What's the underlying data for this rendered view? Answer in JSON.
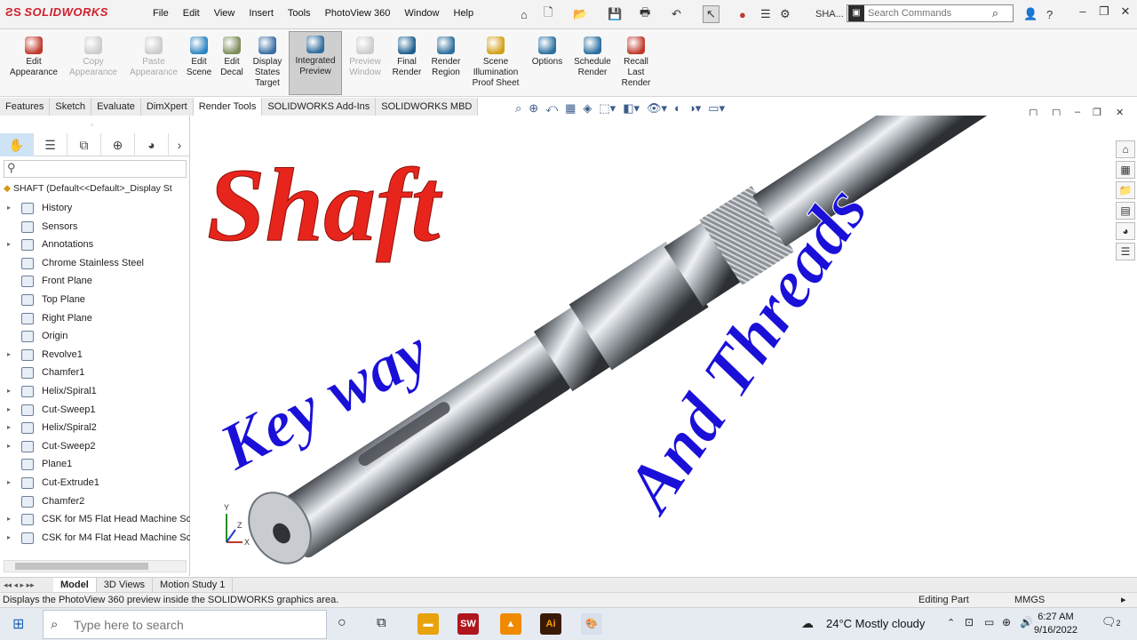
{
  "app": {
    "logo_text": "SOLIDWORKS",
    "menu": [
      "File",
      "Edit",
      "View",
      "Insert",
      "Tools",
      "PhotoView 360",
      "Window",
      "Help"
    ],
    "doc_title": "SHA...",
    "search_placeholder": "Search Commands"
  },
  "ribbon": [
    {
      "label": "Edit Appearance",
      "icon": "appearance-icon",
      "color": "#c0392b",
      "state": "normal"
    },
    {
      "label": "Copy Appearance",
      "icon": "copy-appearance-icon",
      "color": "#cccccc",
      "state": "disabled"
    },
    {
      "label": "Paste Appearance",
      "icon": "paste-appearance-icon",
      "color": "#cccccc",
      "state": "disabled"
    },
    {
      "label": "Edit Scene",
      "icon": "scene-icon",
      "color": "#2e86c1",
      "state": "normal"
    },
    {
      "label": "Edit Decal",
      "icon": "decal-icon",
      "color": "#7d8c5a",
      "state": "normal"
    },
    {
      "label": "Display States Target",
      "icon": "display-states-icon",
      "color": "#3a6ea5",
      "state": "normal"
    },
    {
      "label": "Integrated Preview",
      "icon": "integrated-preview-icon",
      "color": "#2f6d9e",
      "state": "active"
    },
    {
      "label": "Preview Window",
      "icon": "preview-window-icon",
      "color": "#cccccc",
      "state": "disabled"
    },
    {
      "label": "Final Render",
      "icon": "final-render-icon",
      "color": "#1f5f8f",
      "state": "normal"
    },
    {
      "label": "Render Region",
      "icon": "render-region-icon",
      "color": "#2d6f9a",
      "state": "normal"
    },
    {
      "label": "Scene Illumination Proof Sheet",
      "icon": "proof-sheet-icon",
      "color": "#d4a017",
      "state": "normal"
    },
    {
      "label": "Options",
      "icon": "options-icon",
      "color": "#2b6fa0",
      "state": "normal"
    },
    {
      "label": "Schedule Render",
      "icon": "schedule-render-icon",
      "color": "#2b6fa0",
      "state": "normal"
    },
    {
      "label": "Recall Last Render",
      "icon": "recall-render-icon",
      "color": "#c0392b",
      "state": "normal"
    }
  ],
  "tabs": [
    {
      "label": "Features",
      "active": false
    },
    {
      "label": "Sketch",
      "active": false
    },
    {
      "label": "Evaluate",
      "active": false
    },
    {
      "label": "DimXpert",
      "active": false
    },
    {
      "label": "Render Tools",
      "active": true
    },
    {
      "label": "SOLIDWORKS Add-Ins",
      "active": false
    },
    {
      "label": "SOLIDWORKS MBD",
      "active": false
    }
  ],
  "tree": {
    "root": "SHAFT  (Default<<Default>_Display St",
    "items": [
      {
        "label": "History",
        "expand": true
      },
      {
        "label": "Sensors",
        "expand": false
      },
      {
        "label": "Annotations",
        "expand": true
      },
      {
        "label": "Chrome Stainless Steel",
        "expand": false
      },
      {
        "label": "Front Plane",
        "expand": false
      },
      {
        "label": "Top Plane",
        "expand": false
      },
      {
        "label": "Right Plane",
        "expand": false
      },
      {
        "label": "Origin",
        "expand": false
      },
      {
        "label": "Revolve1",
        "expand": true
      },
      {
        "label": "Chamfer1",
        "expand": false
      },
      {
        "label": "Helix/Spiral1",
        "expand": true
      },
      {
        "label": "Cut-Sweep1",
        "expand": true
      },
      {
        "label": "Helix/Spiral2",
        "expand": true
      },
      {
        "label": "Cut-Sweep2",
        "expand": true
      },
      {
        "label": "Plane1",
        "expand": false
      },
      {
        "label": "Cut-Extrude1",
        "expand": true
      },
      {
        "label": "Chamfer2",
        "expand": false
      },
      {
        "label": "CSK for M5 Flat Head Machine Sc",
        "expand": true
      },
      {
        "label": "CSK for M4 Flat Head Machine Sc",
        "expand": true
      }
    ]
  },
  "overlay": {
    "title": "Shaft",
    "keyway": "Key way",
    "threads": "And Threads",
    "title_color": "#e8251c",
    "text_color": "#1a10d8"
  },
  "bottom_tabs": [
    {
      "label": "Model",
      "active": true
    },
    {
      "label": "3D Views",
      "active": false
    },
    {
      "label": "Motion Study 1",
      "active": false
    }
  ],
  "status": {
    "message": "Displays the PhotoView 360 preview inside the SOLIDWORKS graphics area.",
    "mode": "Editing Part",
    "units": "MMGS"
  },
  "taskbar": {
    "search_placeholder": "Type here to search",
    "weather": "24°C  Mostly cloudy",
    "time": "6:27 AM",
    "date": "9/16/2022",
    "notifications": "2"
  }
}
